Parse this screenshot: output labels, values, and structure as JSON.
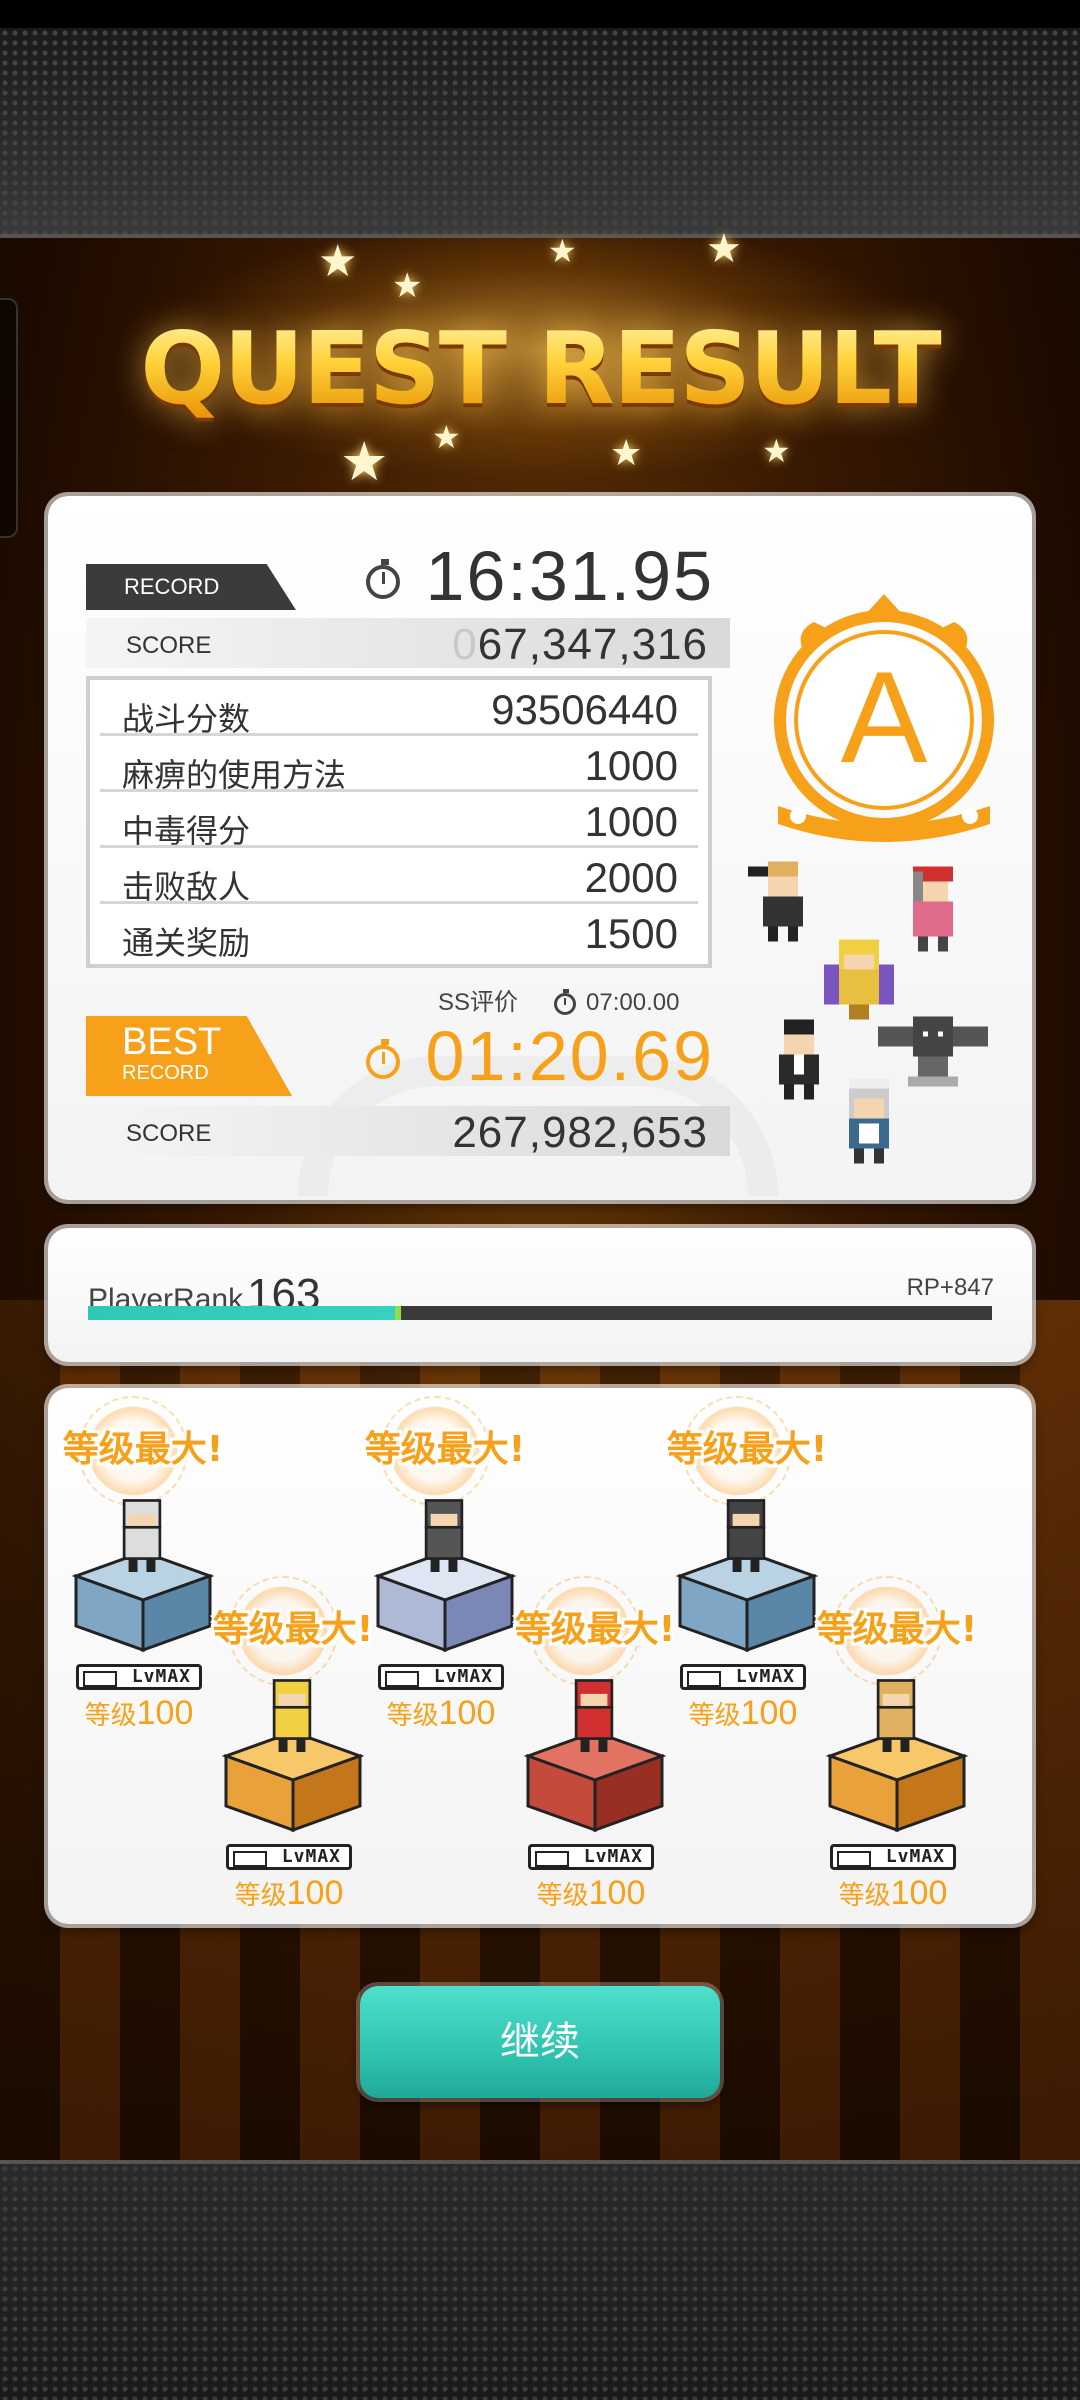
{
  "title": "QUEST RESULT",
  "record": {
    "tag": "RECORD",
    "time": "16:31.95",
    "score_label": "SCORE",
    "score_leading": "0",
    "score_value": "67,347,316"
  },
  "breakdown": [
    {
      "label": "战斗分数",
      "value": "93506440"
    },
    {
      "label": "麻痹的使用方法",
      "value": "1000"
    },
    {
      "label": "中毒得分",
      "value": "1000"
    },
    {
      "label": "击败敌人",
      "value": "2000"
    },
    {
      "label": "通关奖励",
      "value": "1500"
    }
  ],
  "ss": {
    "label": "SS评价",
    "time": "07:00.00"
  },
  "best": {
    "tag_line1": "BEST",
    "tag_line2": "RECORD",
    "time": "01:20.69",
    "score_label": "SCORE",
    "score_value": "267,982,653"
  },
  "rank": {
    "letter": "A",
    "color": "#f7a11a"
  },
  "player_rank": {
    "label": "PlayerRank",
    "value": "163",
    "rp": "RP+847",
    "progress": 0.34
  },
  "units": [
    {
      "burst": "等级最大!",
      "badge": "LvMAX",
      "level_prefix": "等级",
      "level": "100",
      "pedestal": "ice"
    },
    {
      "burst": "等级最大!",
      "badge": "LvMAX",
      "level_prefix": "等级",
      "level": "100",
      "pedestal": "gold"
    },
    {
      "burst": "等级最大!",
      "badge": "LvMAX",
      "level_prefix": "等级",
      "level": "100",
      "pedestal": "crystal"
    },
    {
      "burst": "等级最大!",
      "badge": "LvMAX",
      "level_prefix": "等级",
      "level": "100",
      "pedestal": "red"
    },
    {
      "burst": "等级最大!",
      "badge": "LvMAX",
      "level_prefix": "等级",
      "level": "100",
      "pedestal": "ice"
    },
    {
      "burst": "等级最大!",
      "badge": "LvMAX",
      "level_prefix": "等级",
      "level": "100",
      "pedestal": "gold"
    }
  ],
  "continue_label": "继续",
  "colors": {
    "accent": "#f7a11a",
    "teal": "#2fc3b0",
    "dark": "#3b3b3b"
  }
}
